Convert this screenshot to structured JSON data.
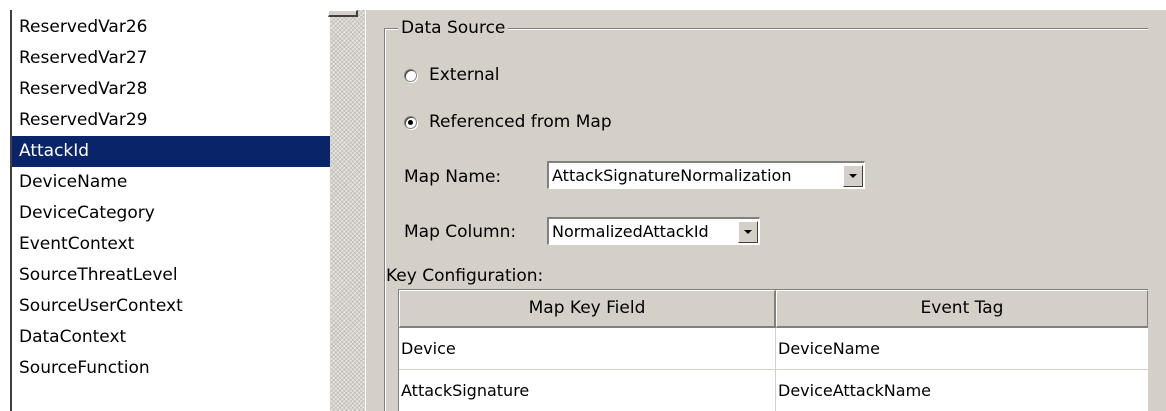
{
  "field_list": {
    "items": [
      "ReservedVar26",
      "ReservedVar27",
      "ReservedVar28",
      "ReservedVar29",
      "AttackId",
      "DeviceName",
      "DeviceCategory",
      "EventContext",
      "SourceThreatLevel",
      "SourceUserContext",
      "DataContext",
      "SourceFunction"
    ],
    "selected": "AttackId"
  },
  "data_source": {
    "group_title": "Data Source",
    "radio_external": {
      "label": "External",
      "checked": false
    },
    "radio_referenced": {
      "label": "Referenced from Map",
      "checked": true
    },
    "map_name_label": "Map Name:",
    "map_name_value": "AttackSignatureNormalization",
    "map_column_label": "Map Column:",
    "map_column_value": "NormalizedAttackId"
  },
  "key_config": {
    "label": "Key Configuration:",
    "columns": [
      "Map Key Field",
      "Event Tag"
    ],
    "rows": [
      [
        "Device",
        "DeviceName"
      ],
      [
        "AttackSignature",
        "DeviceAttackName"
      ]
    ]
  },
  "colors": {
    "selection": "#0a246a",
    "dialog_face": "#d4d0c8"
  }
}
